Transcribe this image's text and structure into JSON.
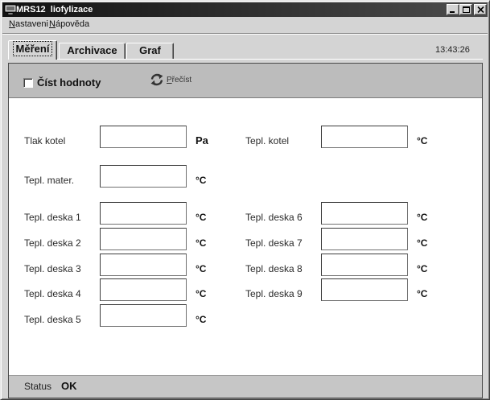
{
  "window": {
    "title": "MRS12  liofylizace",
    "app_icon": "app-icon",
    "controls": [
      "minimize-icon",
      "maximize-icon",
      "close-icon"
    ]
  },
  "menu": {
    "items": [
      {
        "label": "Nastaveni"
      },
      {
        "label": "Nápověda"
      }
    ]
  },
  "tabs": {
    "items": [
      {
        "label": "Měření",
        "selected": true
      },
      {
        "label": "Archivace",
        "selected": false
      },
      {
        "label": "Graf",
        "selected": false
      }
    ],
    "clock": "13:43:26"
  },
  "toolbar": {
    "read_values_label": "Číst hodnoty",
    "read_values_checked": false,
    "reread_icon": "refresh-icon",
    "reread_label": "Přečíst"
  },
  "fields": {
    "left": [
      {
        "label": "Tlak kotel",
        "value": "",
        "unit": "Pa"
      },
      {
        "label": "Tepl. mater.",
        "value": "",
        "unit": "°C"
      },
      {
        "label": "Tepl. deska 1",
        "value": "",
        "unit": "°C"
      },
      {
        "label": "Tepl. deska 2",
        "value": "",
        "unit": "°C"
      },
      {
        "label": "Tepl. deska 3",
        "value": "",
        "unit": "°C"
      },
      {
        "label": "Tepl. deska 4",
        "value": "",
        "unit": "°C"
      },
      {
        "label": "Tepl. deska 5",
        "value": "",
        "unit": "°C"
      }
    ],
    "right": [
      {
        "label": "Tepl. kotel",
        "value": "",
        "unit": "°C"
      },
      {
        "label": "Tepl. deska 6",
        "value": "",
        "unit": "°C"
      },
      {
        "label": "Tepl. deska 7",
        "value": "",
        "unit": "°C"
      },
      {
        "label": "Tepl. deska 8",
        "value": "",
        "unit": "°C"
      },
      {
        "label": "Tepl. deska 9",
        "value": "",
        "unit": "°C"
      }
    ]
  },
  "status": {
    "label": "Status",
    "value": "OK"
  }
}
